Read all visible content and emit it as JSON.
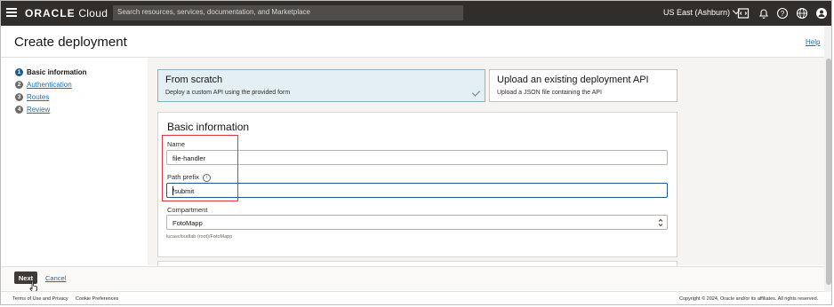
{
  "header": {
    "brand_prefix": "ORACLE",
    "brand_suffix": "Cloud",
    "search_placeholder": "Search resources, services, documentation, and Marketplace",
    "region": "US East (Ashburn)",
    "icons": [
      "menu-icon",
      "code-editor-icon",
      "notifications-icon",
      "help-icon",
      "language-icon",
      "profile-icon"
    ]
  },
  "page": {
    "title": "Create deployment",
    "help_link": "Help"
  },
  "steps": [
    {
      "number": "1",
      "label": "Basic information",
      "active": true
    },
    {
      "number": "2",
      "label": "Authentication",
      "active": false
    },
    {
      "number": "3",
      "label": "Routes",
      "active": false
    },
    {
      "number": "4",
      "label": "Review",
      "active": false
    }
  ],
  "options": [
    {
      "title": "From scratch",
      "description": "Deploy a custom API using the provided form",
      "selected": true
    },
    {
      "title": "Upload an existing deployment API",
      "description": "Upload a JSON file containing the API",
      "selected": false
    }
  ],
  "form": {
    "section_title": "Basic information",
    "name_label": "Name",
    "name_value": "file-handler",
    "path_prefix_label": "Path prefix",
    "path_prefix_value": "/submit",
    "compartment_label": "Compartment",
    "compartment_value": "FotoMapp",
    "compartment_hint": "lucascloudlab (root)/FotoMapp"
  },
  "actions": {
    "next_label": "Next",
    "cancel_label": "Cancel"
  },
  "footer": {
    "terms": "Terms of Use and Privacy",
    "cookies": "Cookie Preferences",
    "copyright": "Copyright © 2024, Oracle and/or its affiliates. All rights reserved."
  },
  "colors": {
    "topbar": "#312d2a",
    "selected_card": "#e3eff3",
    "link": "#1b6fb8",
    "highlight_box": "#d9393a",
    "primary_button": "#3d3a37"
  }
}
